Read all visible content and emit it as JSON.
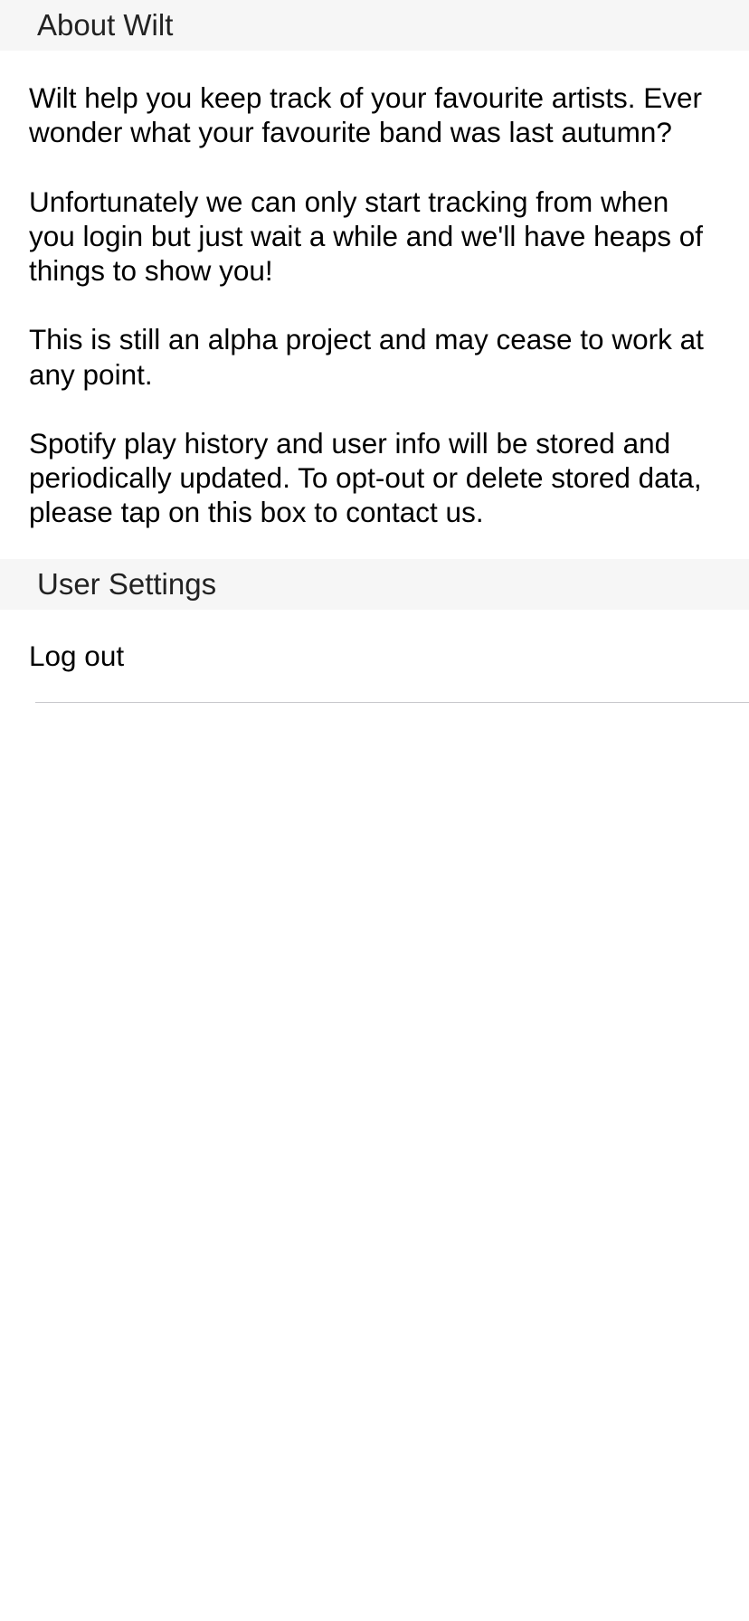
{
  "about": {
    "header": "About Wilt",
    "paragraphs": [
      "Wilt help you keep track of your favourite artists. Ever wonder what your favourite band was last autumn?",
      "Unfortunately we can only start tracking from when you login but just wait a while and we'll have heaps of things to show you!",
      "This is still an alpha project and may cease to work at any point.",
      "Spotify play history and user info will be stored and periodically updated. To opt-out or delete stored data, please tap on this box to contact us."
    ]
  },
  "user_settings": {
    "header": "User Settings",
    "items": [
      {
        "label": "Log out"
      }
    ]
  },
  "colors": {
    "section_header_bg": "#f6f6f6",
    "separator": "#c8c8cc"
  }
}
